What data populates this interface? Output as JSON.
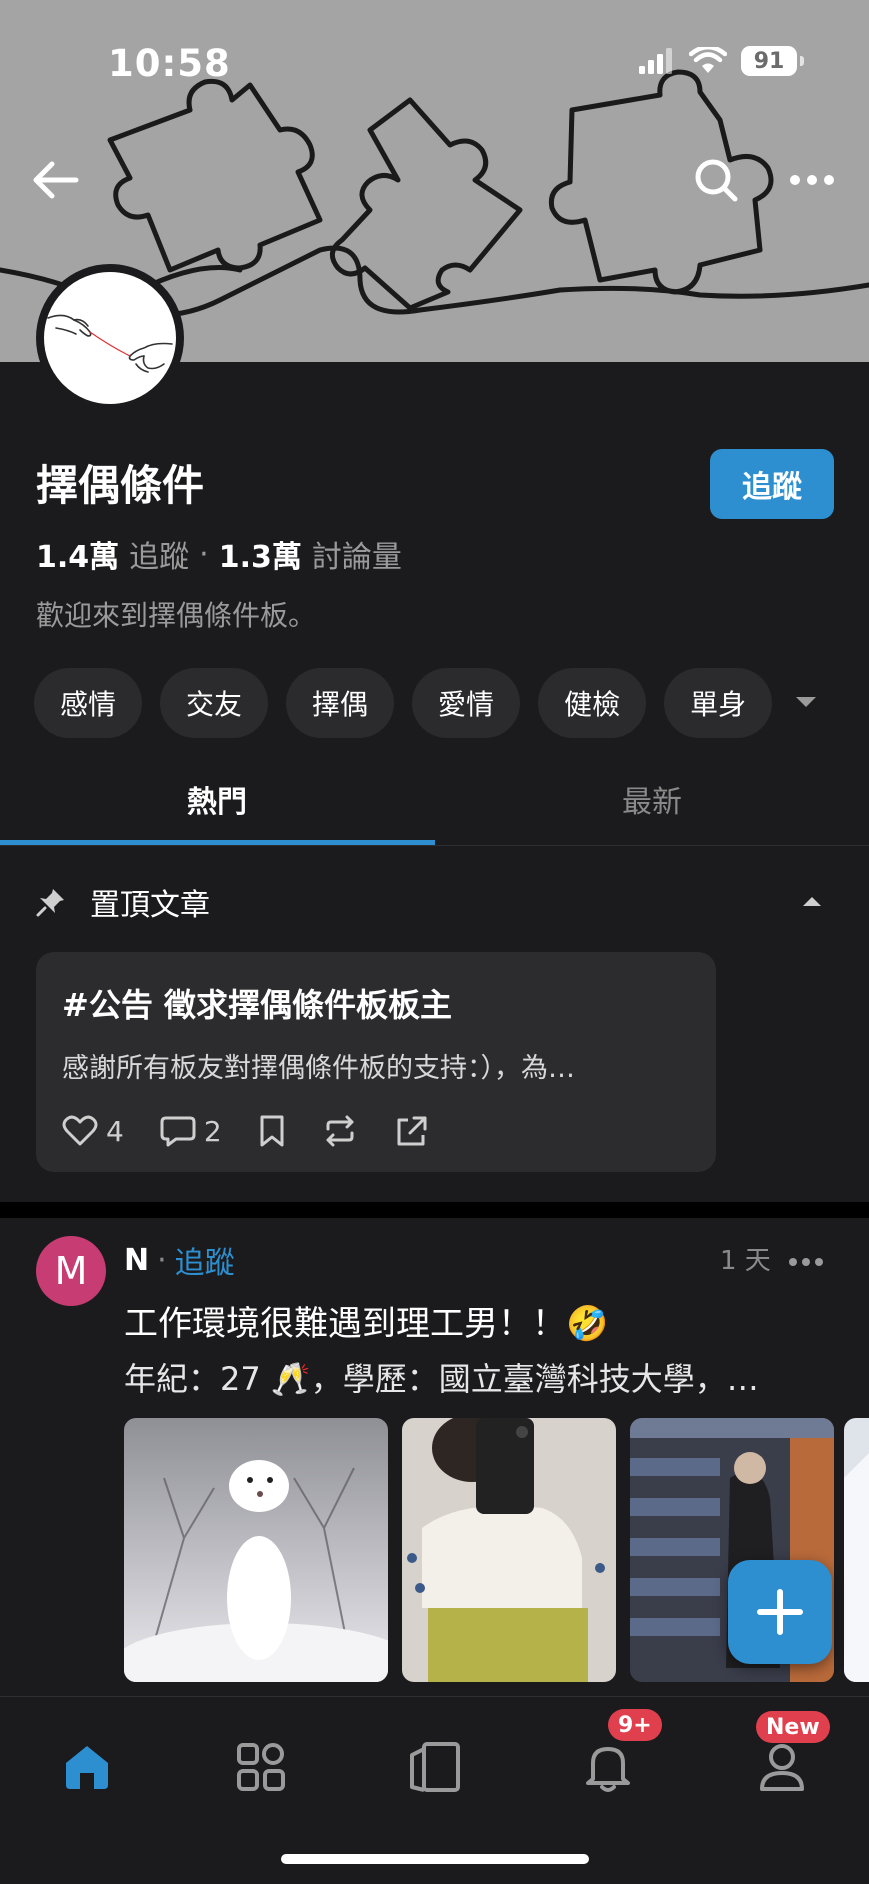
{
  "status_bar": {
    "time": "10:58",
    "battery": "91"
  },
  "board": {
    "title": "擇偶條件",
    "follow_button": "追蹤",
    "followers_count": "1.4萬",
    "followers_label": "追蹤",
    "stat_separator": "·",
    "discussion_count": "1.3萬",
    "discussion_label": "討論量",
    "description": "歡迎來到擇偶條件板。",
    "tags": [
      "感情",
      "交友",
      "擇偶",
      "愛情",
      "健檢",
      "單身"
    ]
  },
  "tabs": [
    "熱門",
    "最新"
  ],
  "pinned": {
    "section_title": "置頂文章",
    "post": {
      "title": "#公告 徵求擇偶條件板板主",
      "excerpt": "感謝所有板友對擇偶條件板的支持：），為…",
      "likes": "4",
      "comments": "2"
    }
  },
  "post": {
    "avatar_letter": "M",
    "author": "N",
    "separator": "·",
    "follow_label": "追蹤",
    "time": "1 天",
    "title": "工作環境很難遇到理工男！！🤣",
    "body": "年紀：27 🥂，學歷：國立臺灣科技大學，…"
  },
  "bottom_nav": {
    "notifications_badge": "9+",
    "profile_badge": "New"
  },
  "colors": {
    "accent": "#2e8fd0",
    "background": "#1b1b1d",
    "card": "#2c2c2f",
    "badge": "#e0404e",
    "avatar": "#c63c73"
  }
}
